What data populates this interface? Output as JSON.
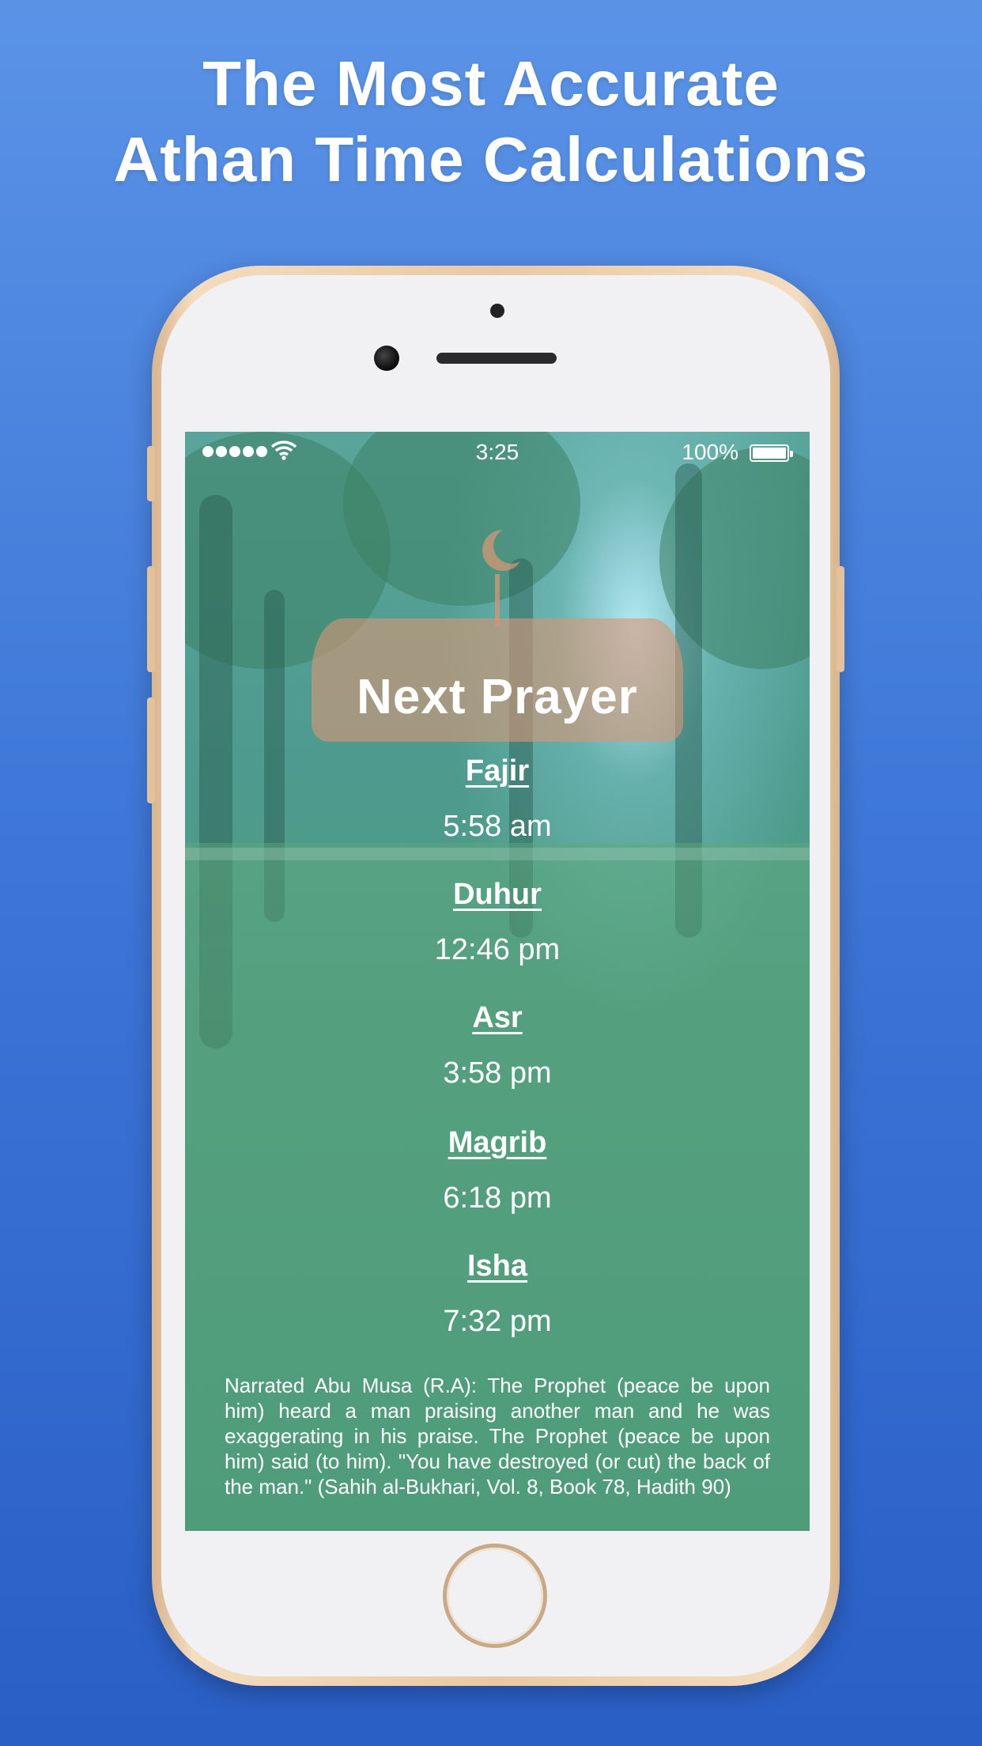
{
  "headline": {
    "line1": "The Most Accurate",
    "line2": "Athan Time Calculations"
  },
  "status_bar": {
    "time": "3:25",
    "battery": "100%"
  },
  "screen": {
    "banner_title": "Next Prayer",
    "prayers": [
      {
        "name": "Fajir",
        "time": "5:58 am"
      },
      {
        "name": "Duhur",
        "time": "12:46 pm"
      },
      {
        "name": "Asr",
        "time": "3:58 pm"
      },
      {
        "name": "Magrib",
        "time": "6:18 pm"
      },
      {
        "name": "Isha",
        "time": "7:32 pm"
      }
    ],
    "hadith": "Narrated Abu Musa (R.A): The Prophet (peace be upon him) heard a man praising another man and he was exaggerating in his praise. The Prophet (peace be upon him) said (to him). \"You have destroyed (or cut) the back of the man.\" (Sahih al-Bukhari, Vol. 8, Book 78, Hadith 90)"
  },
  "colors": {
    "background_top": "#5a93e6",
    "background_bottom": "#2a5fc6",
    "banner": "#d6967660",
    "phone_frame": "#e9c9a3"
  },
  "icons": [
    "moon-icon",
    "wifi-icon",
    "battery-icon",
    "signal-icon"
  ]
}
